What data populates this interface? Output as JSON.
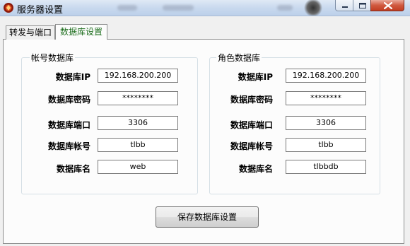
{
  "window": {
    "title": "服务器设置"
  },
  "tabs": [
    {
      "label": "转发与端口",
      "active": false
    },
    {
      "label": "数据库设置",
      "active": true
    }
  ],
  "account_db": {
    "title": "帐号数据库",
    "fields": [
      {
        "label": "数据库IP",
        "value": "192.168.200.200"
      },
      {
        "label": "数据库密码",
        "value": "********"
      },
      {
        "label": "数据库端口",
        "value": "3306"
      },
      {
        "label": "数据库帐号",
        "value": "tlbb"
      },
      {
        "label": "数据库名",
        "value": "web"
      }
    ]
  },
  "role_db": {
    "title": "角色数据库",
    "fields": [
      {
        "label": "数据库IP",
        "value": "192.168.200.200"
      },
      {
        "label": "数据库密码",
        "value": "********"
      },
      {
        "label": "数据库端口",
        "value": "3306"
      },
      {
        "label": "数据库帐号",
        "value": "tlbb"
      },
      {
        "label": "数据库名",
        "value": "tlbbdb"
      }
    ]
  },
  "save_button": {
    "label": "保存数据库设置"
  },
  "colors": {
    "active_tab_text": "#1f6f1f",
    "close_button": "#c23d22",
    "panel_bg": "#fcfcfc"
  }
}
